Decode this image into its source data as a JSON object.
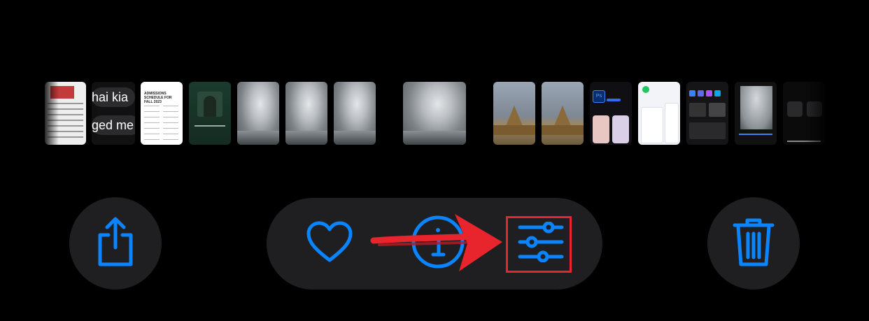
{
  "colors": {
    "background": "#000000",
    "control_bg": "#1f1f21",
    "accent_blue": "#0a84ff",
    "annotation_red": "#e8242d"
  },
  "thumbnails": [
    {
      "kind": "document-screenshot"
    },
    {
      "kind": "messages-screenshot",
      "bubbles": [
        "hai kia",
        "ged me"
      ]
    },
    {
      "kind": "document-screenshot",
      "heading": "ADMISSIONS SCHEDULE FOR FALL 2023"
    },
    {
      "kind": "music-player-screenshot"
    },
    {
      "kind": "photo-cloudy-sea"
    },
    {
      "kind": "photo-cloudy-sea"
    },
    {
      "kind": "photo-cloudy-sea"
    },
    {
      "kind": "photo-cloudy-sea",
      "selected": true
    },
    {
      "kind": "photo-temple"
    },
    {
      "kind": "photo-temple"
    },
    {
      "kind": "app-store-screenshot",
      "icon_label": "Ps"
    },
    {
      "kind": "app-store-screenshot"
    },
    {
      "kind": "photo-editor-screenshot"
    },
    {
      "kind": "photo-edit-screenshot"
    },
    {
      "kind": "edit-tools-screenshot"
    }
  ],
  "toolbar": {
    "share_icon": "share-icon",
    "favorite_icon": "heart-icon",
    "info_icon": "info-icon",
    "adjust_icon": "sliders-icon",
    "delete_icon": "trash-icon"
  },
  "annotation": {
    "arrow": "red-arrow",
    "box": "red-rectangle",
    "target": "adjust-button"
  }
}
